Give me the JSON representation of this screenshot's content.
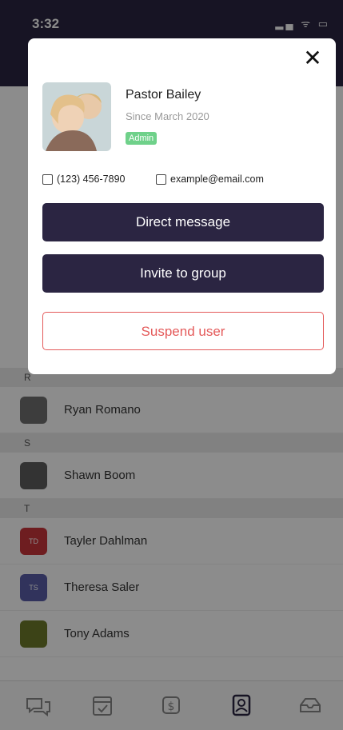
{
  "status_bar": {
    "time": "3:32",
    "signals": "▂▄ ᯤ ▭"
  },
  "contacts": {
    "sections": [
      {
        "letter": "R",
        "items": [
          {
            "name": "Ryan Romano",
            "avatar_color": "#6f6f6f",
            "initials": ""
          }
        ]
      },
      {
        "letter": "S",
        "items": [
          {
            "name": "Shawn Boom",
            "avatar_color": "#5e5e5e",
            "initials": ""
          }
        ]
      },
      {
        "letter": "T",
        "items": [
          {
            "name": "Tayler Dahlman",
            "avatar_color": "#c9363b",
            "initials": "TD"
          },
          {
            "name": "Theresa Saler",
            "avatar_color": "#5a5ea8",
            "initials": "TS"
          },
          {
            "name": "Tony Adams",
            "avatar_color": "#6d7a2b",
            "initials": ""
          }
        ]
      }
    ]
  },
  "modal": {
    "close_label": "✕",
    "profile": {
      "name": "Pastor Bailey",
      "since": "Since March 2020",
      "role_badge": "Admin"
    },
    "phone": "(123) 456-7890",
    "email": "example@email.com",
    "buttons": {
      "direct_message": "Direct message",
      "invite_to_group": "Invite to group",
      "suspend_user": "Suspend user"
    }
  },
  "tabbar": {
    "icons": [
      "chat-icon",
      "calendar-icon",
      "donate-icon",
      "contacts-icon",
      "inbox-icon"
    ]
  },
  "colors": {
    "brand": "#2b2542",
    "danger": "#e45a5a",
    "badge": "#6fd18a"
  }
}
